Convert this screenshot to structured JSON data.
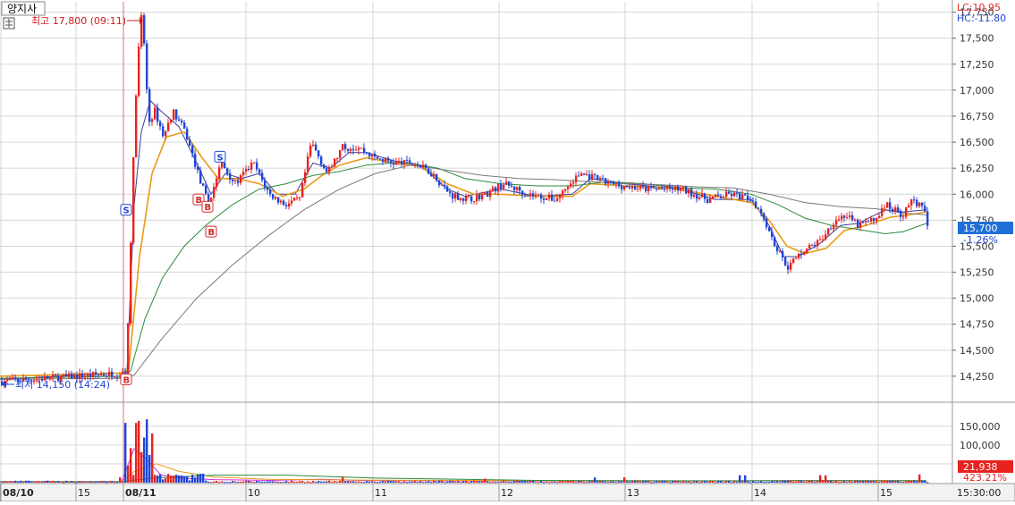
{
  "title": "양지사",
  "colors": {
    "up": "#e8231f",
    "down": "#1f45d6",
    "grid": "#d6d6d6",
    "ma5": "#3b3b9c",
    "ma10": "#e89a14",
    "ma20": "#2c8a3a",
    "ma60": "#7a7a7a",
    "accent": "#e8231f",
    "priceTag": "#1f6fd6",
    "volTag": "#e8231f",
    "signalS": "#1f45d6",
    "signalB": "#d62828"
  },
  "header": {
    "lc": "LC:10.95",
    "hc": "HC:-11.80"
  },
  "annotations": {
    "high": "최고 17,800 (09:11)",
    "low": "최저 14,150 (14:24)"
  },
  "price_tag": {
    "price": "15,700",
    "change": "-1.26%"
  },
  "volume_tag": {
    "volume": "21,938",
    "ratio": "423.21%"
  },
  "chart_data": {
    "type": "candlestick",
    "price_axis": {
      "min": 14000,
      "max": 17850,
      "ticks": [
        14250,
        14500,
        14750,
        15000,
        15250,
        15500,
        15750,
        16000,
        16250,
        16500,
        16750,
        17000,
        17250,
        17500,
        17750
      ],
      "tick_labels": [
        "14,250",
        "14,500",
        "14,750",
        "15,000",
        "15,250",
        "15,500",
        "15,750",
        "16,000",
        "16,250",
        "16,500",
        "16,750",
        "17,000",
        "17,250",
        "17,500",
        "17,750"
      ]
    },
    "volume_axis": {
      "min": 0,
      "max": 190000,
      "ticks": [
        50000,
        100000,
        150000
      ],
      "tick_labels": [
        "50,000",
        "100,000",
        "150,000"
      ]
    },
    "x_axis": {
      "labels": [
        "08/10",
        "15",
        "08/11",
        "10",
        "11",
        "12",
        "13",
        "14",
        "15",
        "15:30:00"
      ]
    },
    "last_price": 15700,
    "high": 17800,
    "low": 14150,
    "signals": [
      {
        "label": "S",
        "price": 15850
      },
      {
        "label": "B",
        "price": 14220
      },
      {
        "label": "B",
        "price": 15950
      },
      {
        "label": "B",
        "price": 15880
      },
      {
        "label": "B",
        "price": 15640
      },
      {
        "label": "S",
        "price": 16360
      }
    ],
    "series": [
      {
        "name": "close",
        "points": [
          [
            0,
            14200
          ],
          [
            136,
            14280
          ],
          [
            140,
            14220
          ],
          [
            147,
            16100
          ],
          [
            152,
            17200
          ],
          [
            158,
            17800
          ],
          [
            162,
            17100
          ],
          [
            166,
            16700
          ],
          [
            172,
            16800
          ],
          [
            182,
            16550
          ],
          [
            192,
            16800
          ],
          [
            206,
            16600
          ],
          [
            222,
            16150
          ],
          [
            232,
            15900
          ],
          [
            246,
            16300
          ],
          [
            262,
            16100
          ],
          [
            282,
            16300
          ],
          [
            300,
            16000
          ],
          [
            318,
            15900
          ],
          [
            334,
            15950
          ],
          [
            347,
            16500
          ],
          [
            365,
            16200
          ],
          [
            382,
            16450
          ],
          [
            400,
            16450
          ],
          [
            418,
            16350
          ],
          [
            440,
            16300
          ],
          [
            462,
            16300
          ],
          [
            482,
            16200
          ],
          [
            502,
            16000
          ],
          [
            522,
            15950
          ],
          [
            542,
            16000
          ],
          [
            562,
            16100
          ],
          [
            590,
            16000
          ],
          [
            620,
            15950
          ],
          [
            648,
            16200
          ],
          [
            680,
            16100
          ],
          [
            720,
            16050
          ],
          [
            760,
            16050
          ],
          [
            790,
            15950
          ],
          [
            816,
            16000
          ],
          [
            840,
            15950
          ],
          [
            852,
            15800
          ],
          [
            866,
            15500
          ],
          [
            880,
            15300
          ],
          [
            896,
            15450
          ],
          [
            916,
            15550
          ],
          [
            932,
            15750
          ],
          [
            944,
            15800
          ],
          [
            958,
            15700
          ],
          [
            976,
            15750
          ],
          [
            990,
            15900
          ],
          [
            1008,
            15800
          ],
          [
            1020,
            15950
          ],
          [
            1032,
            15850
          ],
          [
            1036,
            15700
          ]
        ]
      },
      {
        "name": "ma5",
        "points": [
          [
            0,
            14220
          ],
          [
            136,
            14280
          ],
          [
            142,
            14300
          ],
          [
            150,
            15900
          ],
          [
            158,
            16600
          ],
          [
            168,
            16900
          ],
          [
            180,
            16800
          ],
          [
            200,
            16650
          ],
          [
            220,
            16300
          ],
          [
            236,
            16000
          ],
          [
            252,
            16200
          ],
          [
            270,
            16150
          ],
          [
            290,
            16200
          ],
          [
            310,
            16000
          ],
          [
            330,
            16000
          ],
          [
            350,
            16300
          ],
          [
            370,
            16250
          ],
          [
            390,
            16400
          ],
          [
            410,
            16400
          ],
          [
            440,
            16320
          ],
          [
            470,
            16280
          ],
          [
            500,
            16050
          ],
          [
            520,
            15980
          ],
          [
            560,
            16050
          ],
          [
            600,
            15980
          ],
          [
            640,
            16000
          ],
          [
            660,
            16150
          ],
          [
            700,
            16100
          ],
          [
            760,
            16050
          ],
          [
            800,
            15950
          ],
          [
            840,
            15950
          ],
          [
            860,
            15700
          ],
          [
            876,
            15400
          ],
          [
            892,
            15400
          ],
          [
            916,
            15520
          ],
          [
            940,
            15700
          ],
          [
            960,
            15720
          ],
          [
            990,
            15850
          ],
          [
            1010,
            15830
          ],
          [
            1036,
            15850
          ]
        ]
      },
      {
        "name": "ma10",
        "points": [
          [
            0,
            14250
          ],
          [
            136,
            14280
          ],
          [
            144,
            14320
          ],
          [
            156,
            15400
          ],
          [
            170,
            16200
          ],
          [
            186,
            16550
          ],
          [
            206,
            16600
          ],
          [
            226,
            16350
          ],
          [
            244,
            16150
          ],
          [
            266,
            16150
          ],
          [
            290,
            16100
          ],
          [
            316,
            15980
          ],
          [
            340,
            16050
          ],
          [
            360,
            16180
          ],
          [
            380,
            16280
          ],
          [
            410,
            16350
          ],
          [
            440,
            16300
          ],
          [
            470,
            16270
          ],
          [
            500,
            16100
          ],
          [
            530,
            16000
          ],
          [
            560,
            16000
          ],
          [
            600,
            15980
          ],
          [
            640,
            15980
          ],
          [
            660,
            16100
          ],
          [
            700,
            16080
          ],
          [
            760,
            16050
          ],
          [
            800,
            15980
          ],
          [
            840,
            15920
          ],
          [
            860,
            15750
          ],
          [
            880,
            15500
          ],
          [
            900,
            15430
          ],
          [
            924,
            15480
          ],
          [
            944,
            15650
          ],
          [
            968,
            15700
          ],
          [
            996,
            15780
          ],
          [
            1016,
            15800
          ],
          [
            1036,
            15830
          ]
        ]
      },
      {
        "name": "ma20",
        "points": [
          [
            0,
            14230
          ],
          [
            136,
            14250
          ],
          [
            146,
            14300
          ],
          [
            162,
            14800
          ],
          [
            182,
            15200
          ],
          [
            206,
            15500
          ],
          [
            230,
            15700
          ],
          [
            260,
            15900
          ],
          [
            290,
            16050
          ],
          [
            320,
            16100
          ],
          [
            350,
            16180
          ],
          [
            380,
            16220
          ],
          [
            410,
            16280
          ],
          [
            450,
            16310
          ],
          [
            490,
            16250
          ],
          [
            520,
            16150
          ],
          [
            560,
            16100
          ],
          [
            600,
            16080
          ],
          [
            640,
            16080
          ],
          [
            680,
            16120
          ],
          [
            720,
            16100
          ],
          [
            760,
            16060
          ],
          [
            800,
            16050
          ],
          [
            840,
            16000
          ],
          [
            870,
            15900
          ],
          [
            900,
            15770
          ],
          [
            930,
            15700
          ],
          [
            960,
            15660
          ],
          [
            990,
            15620
          ],
          [
            1010,
            15640
          ],
          [
            1036,
            15720
          ]
        ]
      },
      {
        "name": "ma60",
        "points": [
          [
            0,
            14220
          ],
          [
            136,
            14230
          ],
          [
            150,
            14260
          ],
          [
            180,
            14600
          ],
          [
            220,
            15000
          ],
          [
            260,
            15320
          ],
          [
            300,
            15600
          ],
          [
            340,
            15850
          ],
          [
            380,
            16050
          ],
          [
            420,
            16200
          ],
          [
            460,
            16280
          ],
          [
            500,
            16230
          ],
          [
            540,
            16180
          ],
          [
            580,
            16150
          ],
          [
            620,
            16140
          ],
          [
            660,
            16120
          ],
          [
            700,
            16100
          ],
          [
            740,
            16090
          ],
          [
            780,
            16070
          ],
          [
            820,
            16060
          ],
          [
            860,
            16000
          ],
          [
            900,
            15920
          ],
          [
            940,
            15880
          ],
          [
            980,
            15860
          ],
          [
            1010,
            15820
          ],
          [
            1036,
            15800
          ]
        ]
      }
    ]
  }
}
